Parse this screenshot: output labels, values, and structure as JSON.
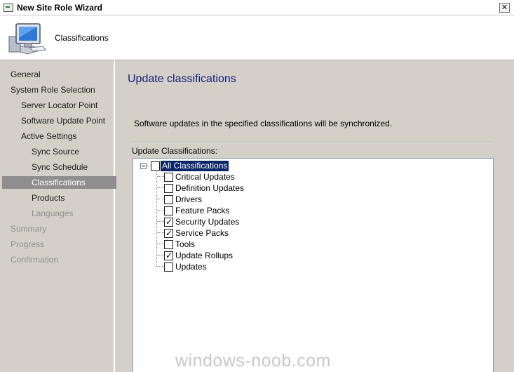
{
  "window": {
    "title": "New Site Role Wizard",
    "close_glyph": "✕"
  },
  "header": {
    "title": "Classifications",
    "icon": "computer-monitor-icon"
  },
  "nav": {
    "items": [
      {
        "label": "General",
        "state": "normal"
      },
      {
        "label": "System Role Selection",
        "state": "normal"
      },
      {
        "label": "Server Locator Point",
        "state": "normal"
      },
      {
        "label": "Software Update Point",
        "state": "normal"
      },
      {
        "label": "Active Settings",
        "state": "normal"
      },
      {
        "label": "Sync Source",
        "state": "normal"
      },
      {
        "label": "Sync Schedule",
        "state": "normal"
      },
      {
        "label": "Classifications",
        "state": "selected"
      },
      {
        "label": "Products",
        "state": "normal"
      },
      {
        "label": "Languages",
        "state": "disabled"
      },
      {
        "label": "Summary",
        "state": "disabled"
      },
      {
        "label": "Progress",
        "state": "disabled"
      },
      {
        "label": "Confirmation",
        "state": "disabled"
      }
    ]
  },
  "content": {
    "title": "Update classifications",
    "description": "Software updates in the specified classifications will be synchronized.",
    "tree_label": "Update Classifications:",
    "root": {
      "label": "All Classifications",
      "checked": false
    },
    "items": [
      {
        "label": "Critical Updates",
        "checked": false
      },
      {
        "label": "Definition Updates",
        "checked": false
      },
      {
        "label": "Drivers",
        "checked": false
      },
      {
        "label": "Feature Packs",
        "checked": false
      },
      {
        "label": "Security Updates",
        "checked": true
      },
      {
        "label": "Service Packs",
        "checked": true
      },
      {
        "label": "Tools",
        "checked": false
      },
      {
        "label": "Update Rollups",
        "checked": true
      },
      {
        "label": "Updates",
        "checked": false
      }
    ]
  },
  "watermark": "windows-noob.com",
  "colors": {
    "selected_nav": "#8e8e8e",
    "title_blue": "#13217a",
    "selection_blue": "#0a246a"
  }
}
